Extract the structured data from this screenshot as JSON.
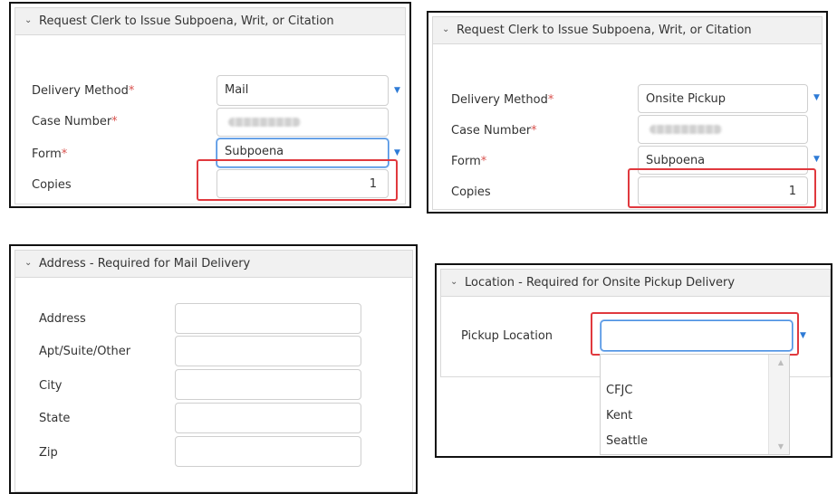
{
  "panel1": {
    "title": "Request Clerk to Issue Subpoena, Writ, or Citation",
    "delivery_method_label": "Delivery Method",
    "case_number_label": "Case Number",
    "form_label": "Form",
    "copies_label": "Copies",
    "required_mark": "*",
    "delivery_method_value": "Mail",
    "form_value": "Subpoena",
    "copies_value": "1"
  },
  "panel2": {
    "title": "Request Clerk to Issue Subpoena, Writ, or Citation",
    "delivery_method_label": "Delivery Method",
    "case_number_label": "Case Number",
    "form_label": "Form",
    "copies_label": "Copies",
    "required_mark": "*",
    "delivery_method_value": "Onsite Pickup",
    "form_value": "Subpoena",
    "copies_value": "1"
  },
  "panel3": {
    "title": "Address - Required for Mail Delivery",
    "address_label": "Address",
    "apt_label": "Apt/Suite/Other",
    "city_label": "City",
    "state_label": "State",
    "zip_label": "Zip"
  },
  "panel4": {
    "title": "Location - Required for Onsite Pickup Delivery",
    "pickup_label": "Pickup Location",
    "options": [
      "CFJC",
      "Kent",
      "Seattle"
    ]
  },
  "icons": {
    "chevron": "chevron-down-icon",
    "caret": "dropdown-caret-icon"
  },
  "colors": {
    "highlight": "#e0393e",
    "accent": "#2e7bd6",
    "required": "#d9534f"
  }
}
